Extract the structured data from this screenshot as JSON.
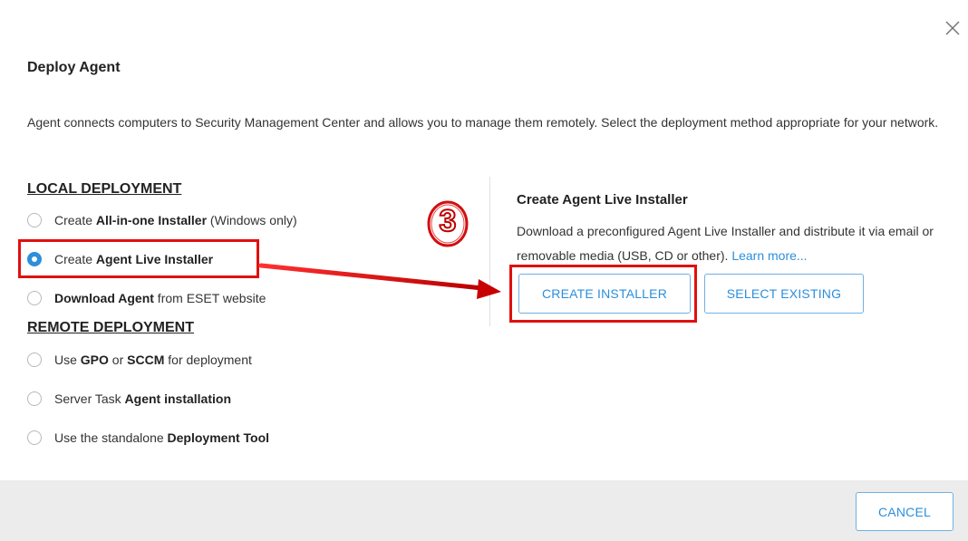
{
  "dialog": {
    "title": "Deploy Agent",
    "description": "Agent connects computers to Security Management Center and allows you to manage them remotely. Select the deployment method appropriate for your network."
  },
  "local": {
    "heading": "LOCAL DEPLOYMENT",
    "options": [
      {
        "pre": "Create ",
        "bold": "All-in-one Installer",
        "post": " (Windows only)",
        "selected": false
      },
      {
        "pre": "Create ",
        "bold": "Agent Live Installer",
        "post": "",
        "selected": true
      },
      {
        "pre": "",
        "bold": "Download Agent",
        "post": " from ESET website",
        "selected": false
      }
    ]
  },
  "remote": {
    "heading": "REMOTE DEPLOYMENT",
    "options": [
      {
        "pre": "Use ",
        "bold": "GPO",
        "mid": " or ",
        "bold2": "SCCM",
        "post": " for deployment",
        "selected": false
      },
      {
        "pre": "Server Task ",
        "bold": "Agent installation",
        "post": "",
        "selected": false
      },
      {
        "pre": "Use the standalone ",
        "bold": "Deployment Tool",
        "post": "",
        "selected": false
      }
    ]
  },
  "panel": {
    "title": "Create Agent Live Installer",
    "description": "Download a preconfigured Agent Live Installer and distribute it via email or removable media (USB, CD or other).",
    "learn_more": "Learn more...",
    "create_button": "CREATE INSTALLER",
    "select_button": "SELECT EXISTING"
  },
  "footer": {
    "cancel_button": "CANCEL"
  },
  "annotation": {
    "step_number": "3"
  },
  "colors": {
    "accent": "#2b8fdc",
    "highlight": "#e01010",
    "footer_bg": "#ececec"
  }
}
